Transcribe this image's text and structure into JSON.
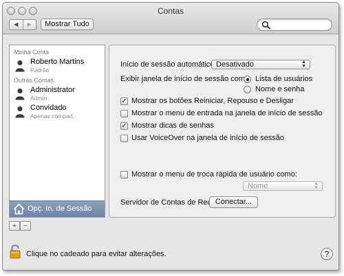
{
  "window": {
    "title": "Contas"
  },
  "toolbar": {
    "back_icon": "◀",
    "forward_icon": "▶",
    "show_all_label": "Mostrar Tudo",
    "search_placeholder": ""
  },
  "sidebar": {
    "my_account_header": "Minha Conta",
    "other_accounts_header": "Outras Contas",
    "accounts": [
      {
        "name": "Roberto Martins",
        "role": "Padrão"
      },
      {
        "name": "Administrator",
        "role": "Admin"
      },
      {
        "name": "Convidado",
        "role": "Apenas compart."
      }
    ],
    "login_options_label": "Opç. In. de Sessão",
    "add_label": "+",
    "remove_label": "−"
  },
  "login_options": {
    "auto_login_label": "Início de sessão automático:",
    "auto_login_value": "Desativado",
    "display_window_label": "Exibir janela de início de sessão como:",
    "radio_options": [
      "Lista de usuários",
      "Nome e senha"
    ],
    "selected_radio": 0,
    "checkboxes": [
      {
        "label": "Mostrar os botões Reiniciar, Repouso e Desligar",
        "checked": true
      },
      {
        "label": "Mostrar o menu de entrada na janela de início de sessão",
        "checked": false
      },
      {
        "label": "Mostrar dicas de senhas",
        "checked": true
      },
      {
        "label": "Usar VoiceOver na janela de início de sessão",
        "checked": false
      }
    ],
    "fast_switch_label": "Mostrar o menu de troca rápida de usuário como:",
    "fast_switch_checked": false,
    "fast_switch_value": "Nome",
    "network_server_label": "Servidor de Contas de Rede:",
    "connect_button_label": "Conectar..."
  },
  "footer": {
    "lock_text": "Clique no cadeado para evitar alterações.",
    "help_label": "?"
  },
  "colors": {
    "selected_sidebar": "#7c8fad",
    "window_bg": "#e6e6e6",
    "lock_body": "#d8a21c"
  }
}
